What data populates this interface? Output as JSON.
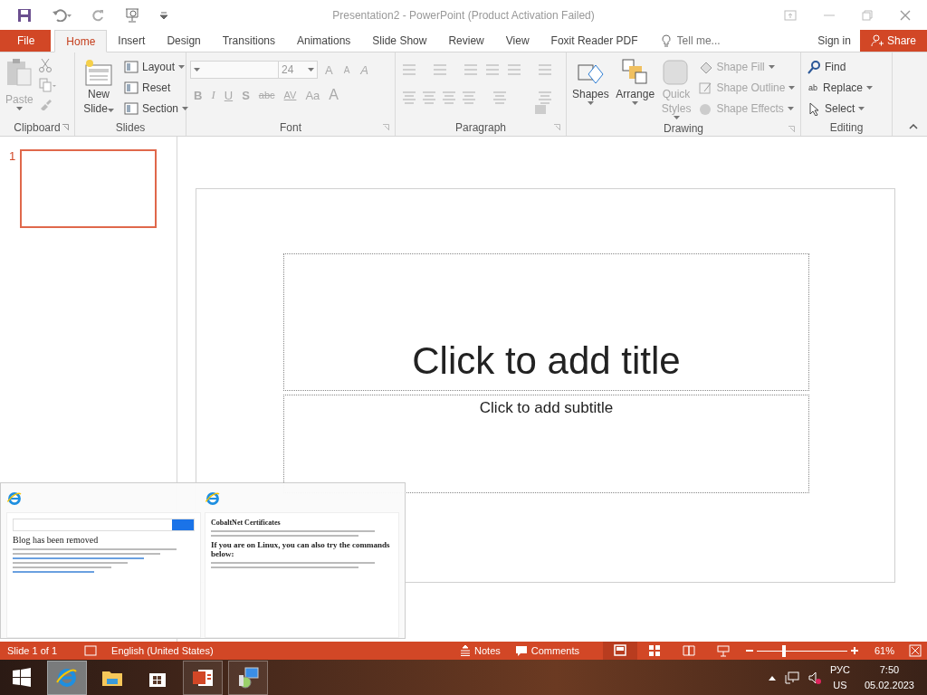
{
  "title_bar": {
    "title": "Presentation2 - PowerPoint (Product Activation Failed)"
  },
  "tabs": [
    {
      "label": "File",
      "kind": "file",
      "selected": false
    },
    {
      "label": "Home",
      "kind": "tab",
      "selected": true
    },
    {
      "label": "Insert",
      "kind": "tab",
      "selected": false
    },
    {
      "label": "Design",
      "kind": "tab",
      "selected": false
    },
    {
      "label": "Transitions",
      "kind": "tab",
      "selected": false
    },
    {
      "label": "Animations",
      "kind": "tab",
      "selected": false
    },
    {
      "label": "Slide Show",
      "kind": "tab",
      "selected": false
    },
    {
      "label": "Review",
      "kind": "tab",
      "selected": false
    },
    {
      "label": "View",
      "kind": "tab",
      "selected": false
    },
    {
      "label": "Foxit Reader PDF",
      "kind": "tab",
      "selected": false
    }
  ],
  "tell_me": {
    "placeholder": "Tell me..."
  },
  "sign_in": "Sign in",
  "share": "Share",
  "clipboard": {
    "label": "Clipboard",
    "paste": {
      "label": "Paste",
      "disabled": true
    }
  },
  "slides": {
    "label": "Slides",
    "new_slide": {
      "label": "New Slide"
    },
    "items": [
      {
        "label": "Layout",
        "caret": true
      },
      {
        "label": "Reset",
        "caret": false
      },
      {
        "label": "Section",
        "caret": true
      }
    ]
  },
  "font": {
    "label": "Font",
    "size": "24",
    "grow": "A",
    "shrink": "A",
    "clear": "A",
    "buttons": [
      {
        "label": "B",
        "kind": "bold"
      },
      {
        "label": "I",
        "kind": "italic"
      },
      {
        "label": "U",
        "kind": "underline"
      },
      {
        "label": "S",
        "kind": "shadow"
      },
      {
        "label": "abc",
        "kind": "strike"
      },
      {
        "label": "AV",
        "kind": "spacing"
      },
      {
        "label": "Aa",
        "kind": "case"
      },
      {
        "label": "A",
        "kind": "color"
      }
    ]
  },
  "paragraph": {
    "label": "Paragraph"
  },
  "drawing": {
    "label": "Drawing",
    "large": [
      {
        "label": "Shapes",
        "kind": "shapes",
        "disabled": false
      },
      {
        "label": "Arrange",
        "kind": "arrange",
        "disabled": false
      },
      {
        "label": "Quick Styles",
        "kind": "styles",
        "disabled": true
      }
    ],
    "small": [
      {
        "label": "Shape Fill",
        "kind": "fill",
        "disabled": true
      },
      {
        "label": "Shape Outline",
        "kind": "outline",
        "disabled": true
      },
      {
        "label": "Shape Effects",
        "kind": "effects",
        "disabled": true
      }
    ]
  },
  "editing": {
    "label": "Editing",
    "items": [
      {
        "label": "Find",
        "kind": "find"
      },
      {
        "label": "Replace",
        "kind": "replace"
      },
      {
        "label": "Select",
        "kind": "select"
      }
    ],
    "replace_icon": "ab"
  },
  "slide_pane": {
    "slides": [
      {
        "number": "1",
        "selected": true
      }
    ]
  },
  "slide": {
    "title_placeholder": "Click to add title",
    "subtitle_placeholder": "Click to add subtitle"
  },
  "thumbnails": [
    {
      "kind": "blog",
      "heading": "Blog has been removed"
    },
    {
      "kind": "certs",
      "heading": "CobaltNet Certificates",
      "subheading": "If you are on Linux, you can also try the commands below:"
    }
  ],
  "status_bar": {
    "slide_info": "Slide 1 of 1",
    "language": "English (United States)",
    "notes": "Notes",
    "comments": "Comments",
    "views": [
      {
        "kind": "normal",
        "selected": true
      },
      {
        "kind": "sorter",
        "selected": false
      },
      {
        "kind": "reading",
        "selected": false
      },
      {
        "kind": "show",
        "selected": false
      }
    ],
    "zoom": {
      "level": 0.3,
      "reading": "61%"
    }
  },
  "taskbar": {
    "items": [
      {
        "kind": "start",
        "selected": false,
        "running": false
      },
      {
        "kind": "browser",
        "selected": true,
        "running": true
      },
      {
        "kind": "folder",
        "selected": false,
        "running": false
      },
      {
        "kind": "store",
        "selected": false,
        "running": false
      },
      {
        "kind": "presentation",
        "selected": false,
        "running": true
      },
      {
        "kind": "installer",
        "selected": false,
        "running": true
      }
    ],
    "language": "РУС",
    "layout": "US",
    "time": "7:50",
    "date": "05.02.2023"
  }
}
